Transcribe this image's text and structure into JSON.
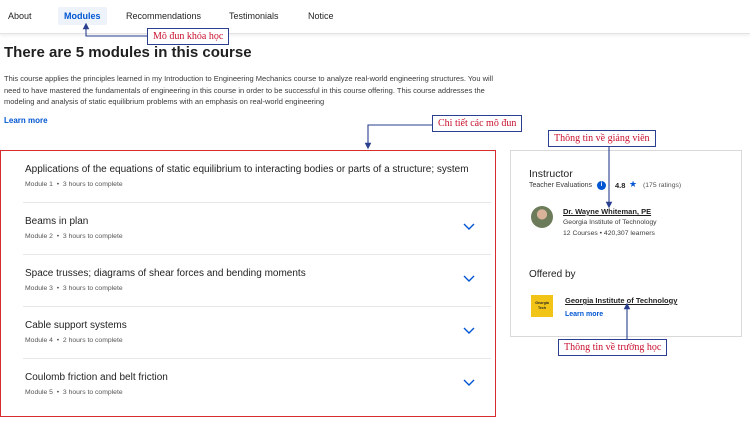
{
  "nav": {
    "items": [
      "About",
      "Modules",
      "Recommendations",
      "Testimonials",
      "Notice"
    ],
    "active_index": 1
  },
  "heading": "There are 5 modules in this course",
  "description": "This course applies the principles learned in my Introduction to Engineering Mechanics course to analyze real-world engineering structures. You will need to have mastered the fundamentals of engineering in this course in order to be successful in this course offering. This course addresses the modeling and analysis of static equilibrium problems with an emphasis on real-world engineering",
  "learn_more": "Learn more",
  "modules": [
    {
      "title": "Applications of the equations of static equilibrium to interacting bodies or parts of a structure; system",
      "module": "Module 1",
      "duration": "3 hours to complete"
    },
    {
      "title": "Beams in plan",
      "module": "Module 2",
      "duration": "3 hours to complete"
    },
    {
      "title": "Space trusses; diagrams of shear forces and bending moments",
      "module": "Module 3",
      "duration": "3 hours to complete"
    },
    {
      "title": "Cable support systems",
      "module": "Module 4",
      "duration": "2 hours to complete"
    },
    {
      "title": "Coulomb friction and belt friction",
      "module": "Module 5",
      "duration": "3 hours to complete"
    }
  ],
  "meta_separator": "•",
  "instructor": {
    "heading": "Instructor",
    "evaluations_label": "Teacher Evaluations",
    "info_icon_char": "i",
    "rating": "4.8",
    "star": "★",
    "ratings_count": "(175 ratings)",
    "name": "Dr. Wayne Whiteman, PE",
    "org": "Georgia Institute of Technology",
    "stats": "12 Courses  •  420,307 learners"
  },
  "offered_by": {
    "heading": "Offered by",
    "logo_text": "Georgia Tech",
    "name": "Georgia Institute of Technology",
    "learn_more": "Learn more"
  },
  "annotations": {
    "modules": "Mô đun khóa học",
    "module_details": "Chi tiết các mô đun",
    "instructor_info": "Thông tin về giảng viên",
    "school_info": "Thông tin về trường học"
  },
  "colors": {
    "accent": "#0056d2",
    "highlight_border": "#d62d2d",
    "annotation_text": "#c8102e",
    "annotation_border": "#2a3f8f"
  }
}
